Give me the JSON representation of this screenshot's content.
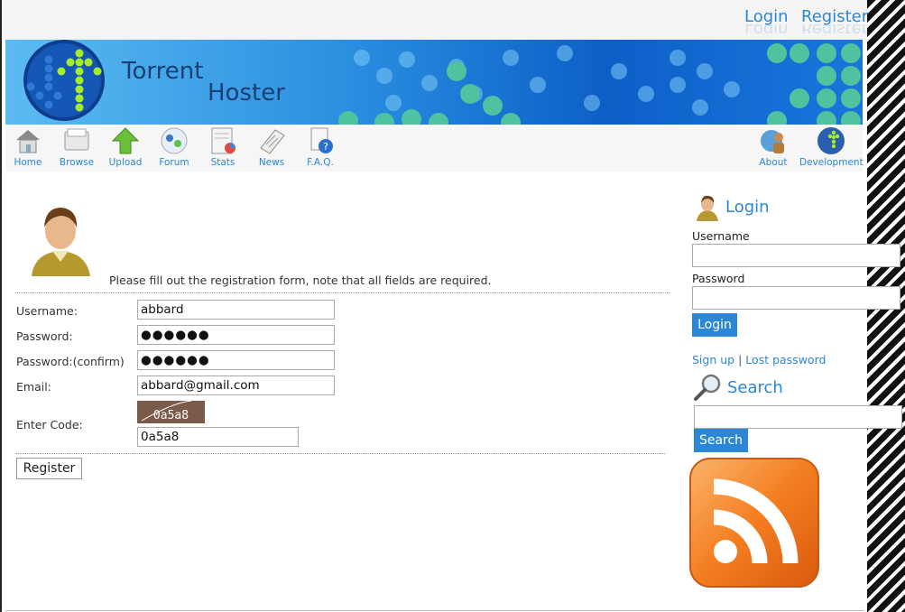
{
  "topbar": {
    "login": "Login",
    "register": "Register"
  },
  "banner": {
    "line1": "Torrent",
    "line2": "Hoster"
  },
  "nav": {
    "left": [
      {
        "label": "Home",
        "icon": "home-icon"
      },
      {
        "label": "Browse",
        "icon": "browse-icon"
      },
      {
        "label": "Upload",
        "icon": "upload-icon"
      },
      {
        "label": "Forum",
        "icon": "forum-icon"
      },
      {
        "label": "Stats",
        "icon": "stats-icon"
      },
      {
        "label": "News",
        "icon": "news-icon"
      },
      {
        "label": "F.A.Q.",
        "icon": "faq-icon"
      }
    ],
    "right": [
      {
        "label": "About",
        "icon": "about-icon"
      },
      {
        "label": "Development",
        "icon": "development-icon"
      }
    ]
  },
  "register_form": {
    "intro": "Please fill out the registration form, note that all fields are required.",
    "username_label": "Username:",
    "username_value": "abbard",
    "password_label": "Password:",
    "password_value": "●●●●●●",
    "password_confirm_label": "Password:(confirm)",
    "password_confirm_value": "●●●●●●",
    "email_label": "Email:",
    "email_value": "abbard@gmail.com",
    "code_label": "Enter Code:",
    "captcha_text": "0a5a8",
    "code_value": "0a5a8",
    "submit": "Register"
  },
  "sidebar": {
    "login": {
      "title": "Login",
      "username_label": "Username",
      "password_label": "Password",
      "button": "Login",
      "signup": "Sign up",
      "separator": "|",
      "lost_password": "Lost password"
    },
    "search": {
      "title": "Search",
      "button": "Search"
    }
  },
  "colors": {
    "accent": "#2b86d6",
    "rss": "#f47d20",
    "banner": "#1a76dc"
  }
}
